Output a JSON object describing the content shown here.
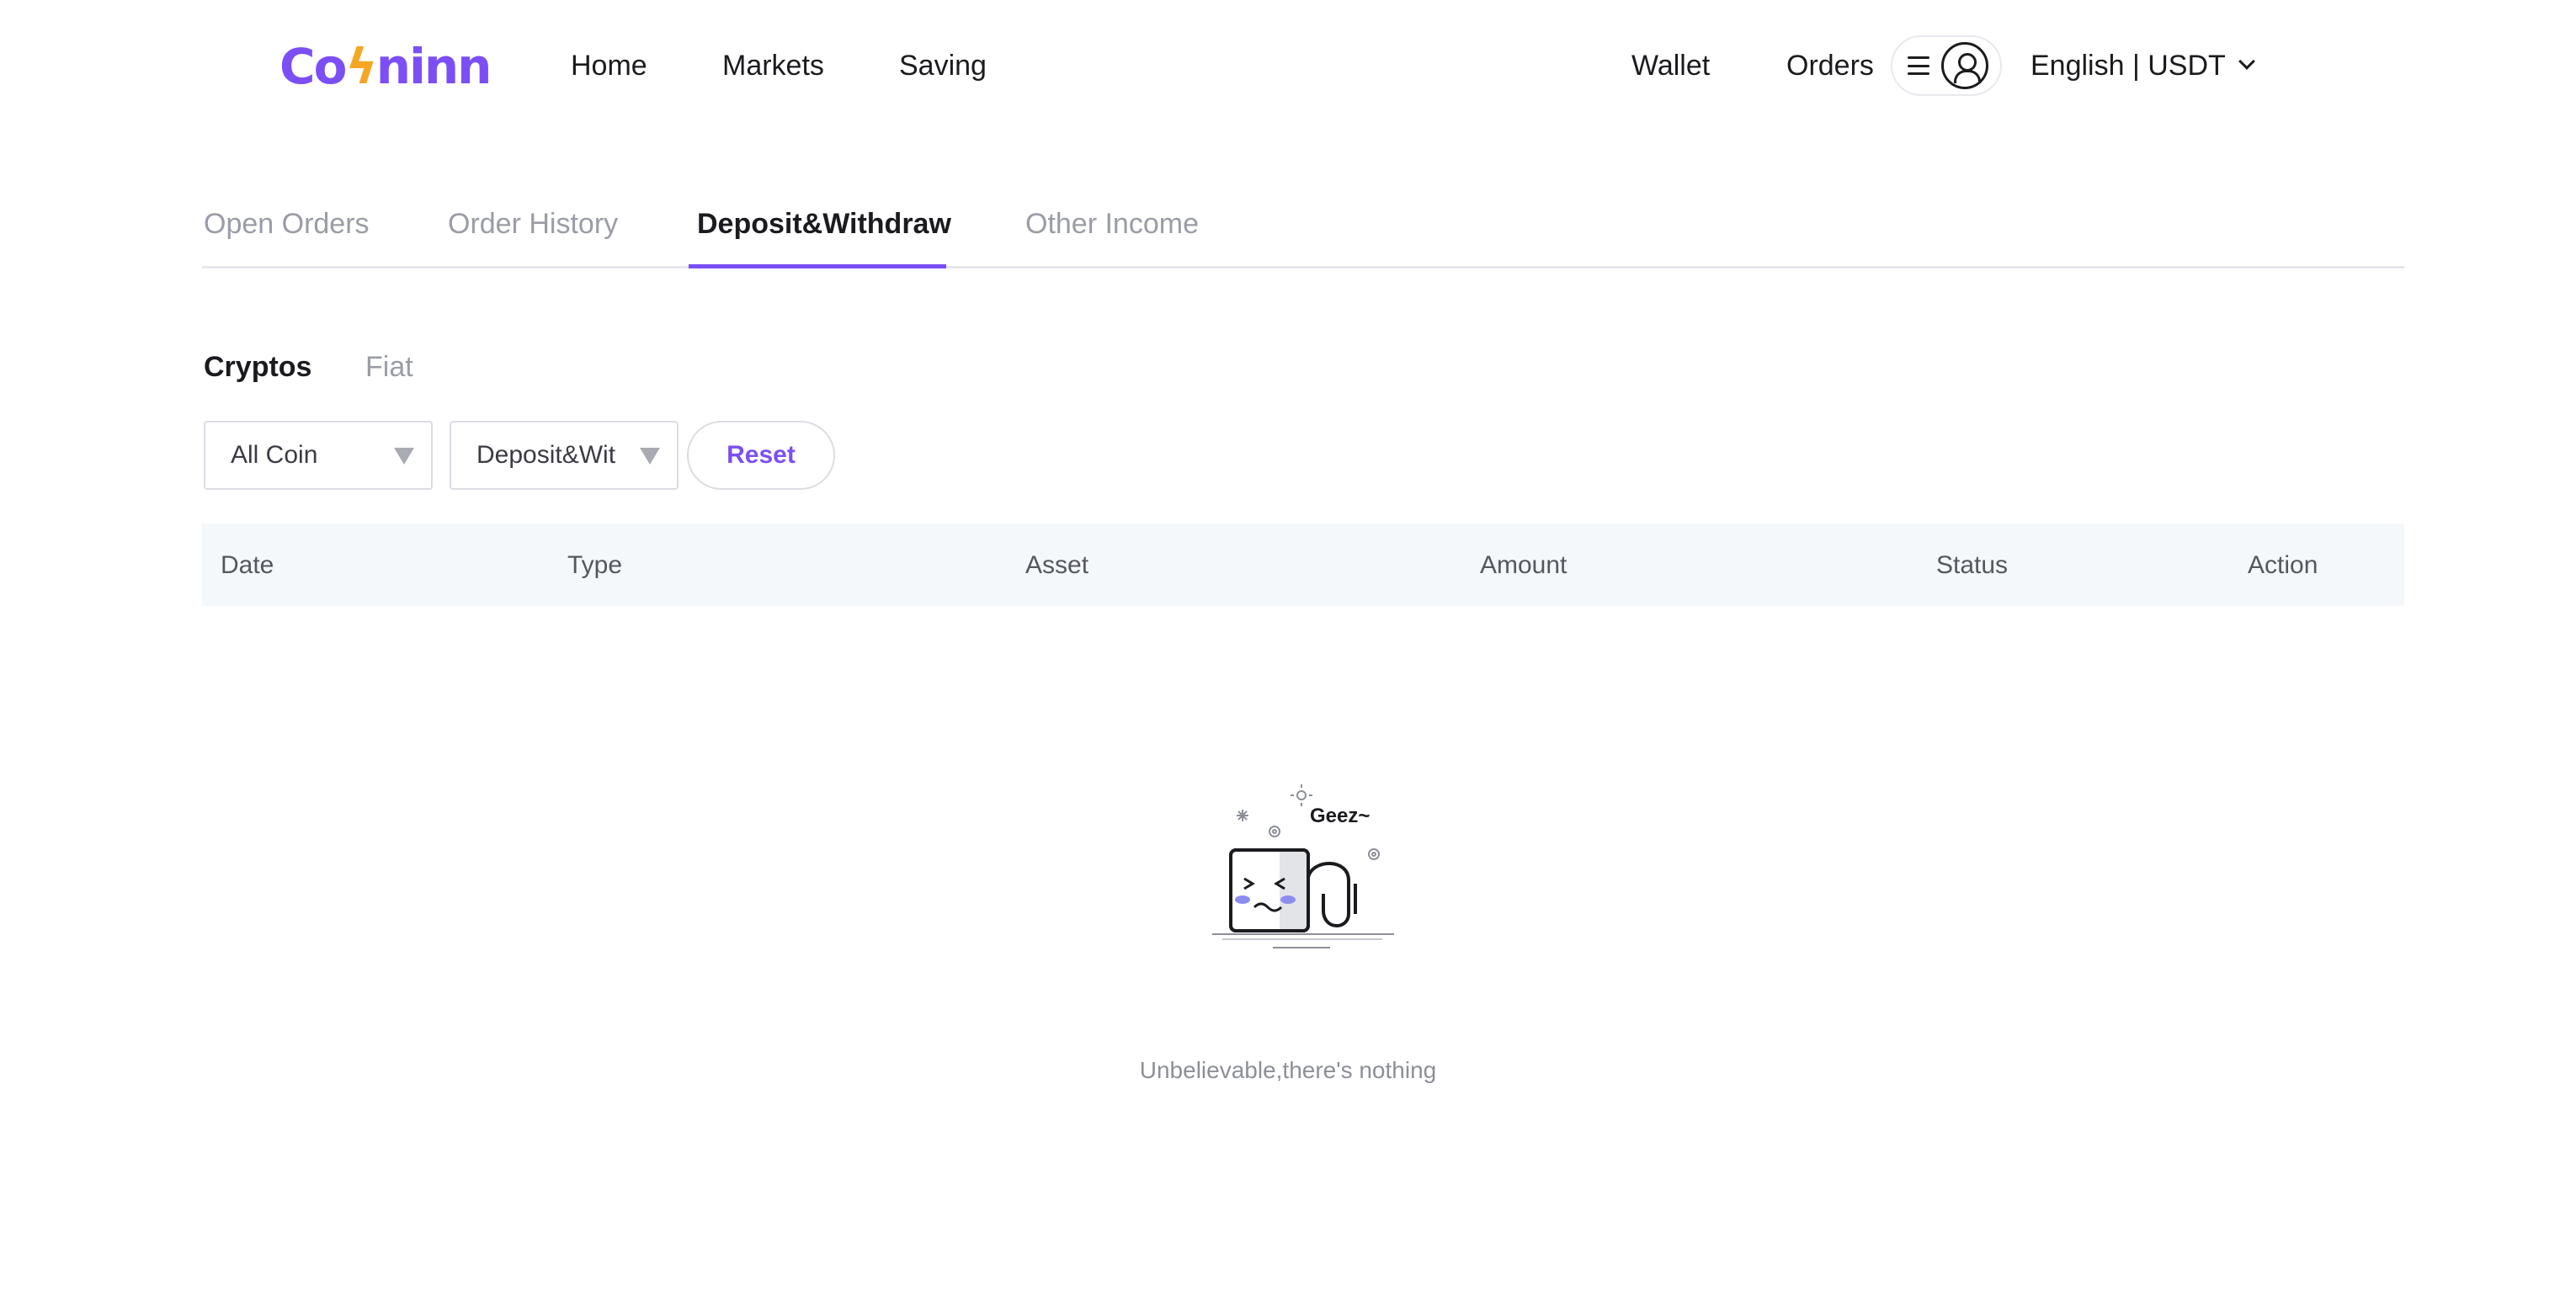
{
  "header": {
    "logo": {
      "part1": "Co",
      "bolt": "ϟ",
      "part2": "ninn"
    },
    "nav": [
      "Home",
      "Markets",
      "Saving"
    ],
    "right_nav": [
      "Wallet",
      "Orders"
    ],
    "language": "English | USDT"
  },
  "tabs": {
    "items": [
      "Open Orders",
      "Order History",
      "Deposit&Withdraw",
      "Other Income"
    ],
    "active": "Deposit&Withdraw"
  },
  "subtabs": {
    "items": [
      "Cryptos",
      "Fiat"
    ],
    "active": "Cryptos"
  },
  "filters": {
    "coin": "All Coin",
    "type": "Deposit&Wit",
    "reset_label": "Reset"
  },
  "table": {
    "columns": [
      "Date",
      "Type",
      "Asset",
      "Amount",
      "Status",
      "Action"
    ],
    "rows": []
  },
  "empty_state": {
    "illustration_label": "Geez~",
    "message": "Unbelievable,there's nothing"
  },
  "colors": {
    "accent": "#7b4ff5",
    "logo_bolt": "#f5a623",
    "table_header_bg": "#f5f8fb"
  },
  "icons": [
    "menu-icon",
    "user-icon",
    "chevron-down-icon",
    "caret-down-icon",
    "empty-state-illustration"
  ]
}
